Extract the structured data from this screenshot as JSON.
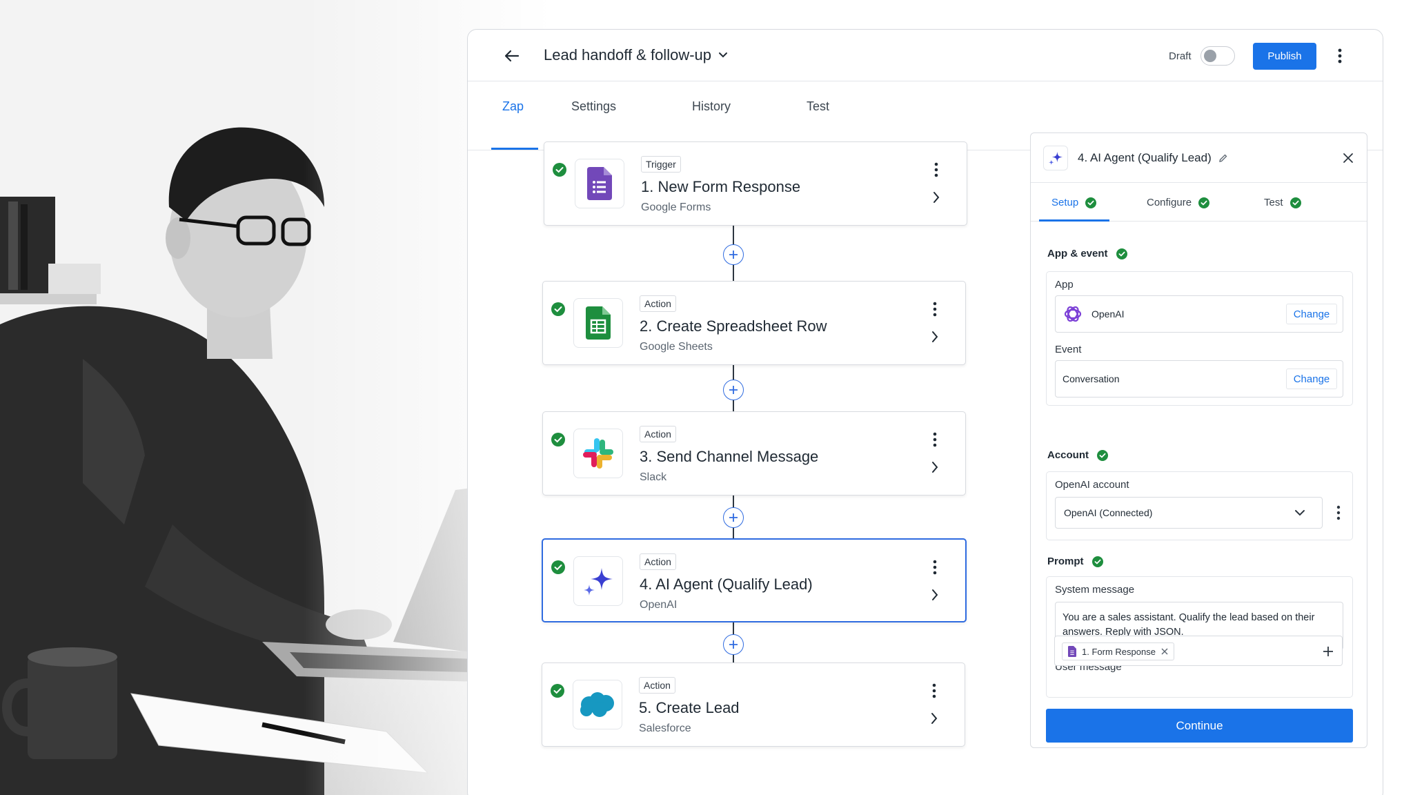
{
  "header": {
    "zap_title": "Lead handoff & follow-up",
    "draft_label": "Draft",
    "publish_label": "Publish"
  },
  "tabs": [
    {
      "label": "Zap",
      "active": true
    },
    {
      "label": "Settings",
      "active": false
    },
    {
      "label": "History",
      "active": false
    },
    {
      "label": "Test",
      "active": false
    }
  ],
  "steps": [
    {
      "kind": "Trigger",
      "title": "1. New Form Response",
      "app": "Google Forms",
      "icon": "google-forms-icon",
      "status": "complete"
    },
    {
      "kind": "Action",
      "title": "2. Create Spreadsheet Row",
      "app": "Google Sheets",
      "icon": "google-sheets-icon",
      "status": "complete"
    },
    {
      "kind": "Action",
      "title": "3. Send Channel Message",
      "app": "Slack",
      "icon": "slack-icon",
      "status": "complete"
    },
    {
      "kind": "Action",
      "title": "4. AI Agent (Qualify Lead)",
      "app": "OpenAI",
      "icon": "ai-sparkle-icon",
      "status": "complete",
      "selected": true
    },
    {
      "kind": "Action",
      "title": "5. Create Lead",
      "app": "Salesforce",
      "icon": "salesforce-icon",
      "status": "complete"
    }
  ],
  "panel": {
    "title": "4. AI Agent (Qualify Lead)",
    "tabs": [
      {
        "label": "Setup",
        "active": true
      },
      {
        "label": "Configure",
        "active": false
      },
      {
        "label": "Test",
        "active": false
      }
    ],
    "app_event": {
      "section_label": "App & event",
      "app_label": "App",
      "app_value": "OpenAI",
      "event_label": "Event",
      "event_value": "Conversation",
      "change_label": "Change"
    },
    "account": {
      "section_label": "Account",
      "field_label": "OpenAI account",
      "selected": "OpenAI (Connected)"
    },
    "prompt": {
      "section_label": "Prompt",
      "system_label": "System message",
      "system_value": "You are a sales assistant. Qualify the lead based on their answers. Reply with JSON.",
      "user_label": "User message",
      "user_chip": "1. Form Response"
    },
    "continue_label": "Continue"
  },
  "colors": {
    "accent": "#1a73e8",
    "success": "#1e8e3e",
    "selected_border": "#2f6be0"
  }
}
